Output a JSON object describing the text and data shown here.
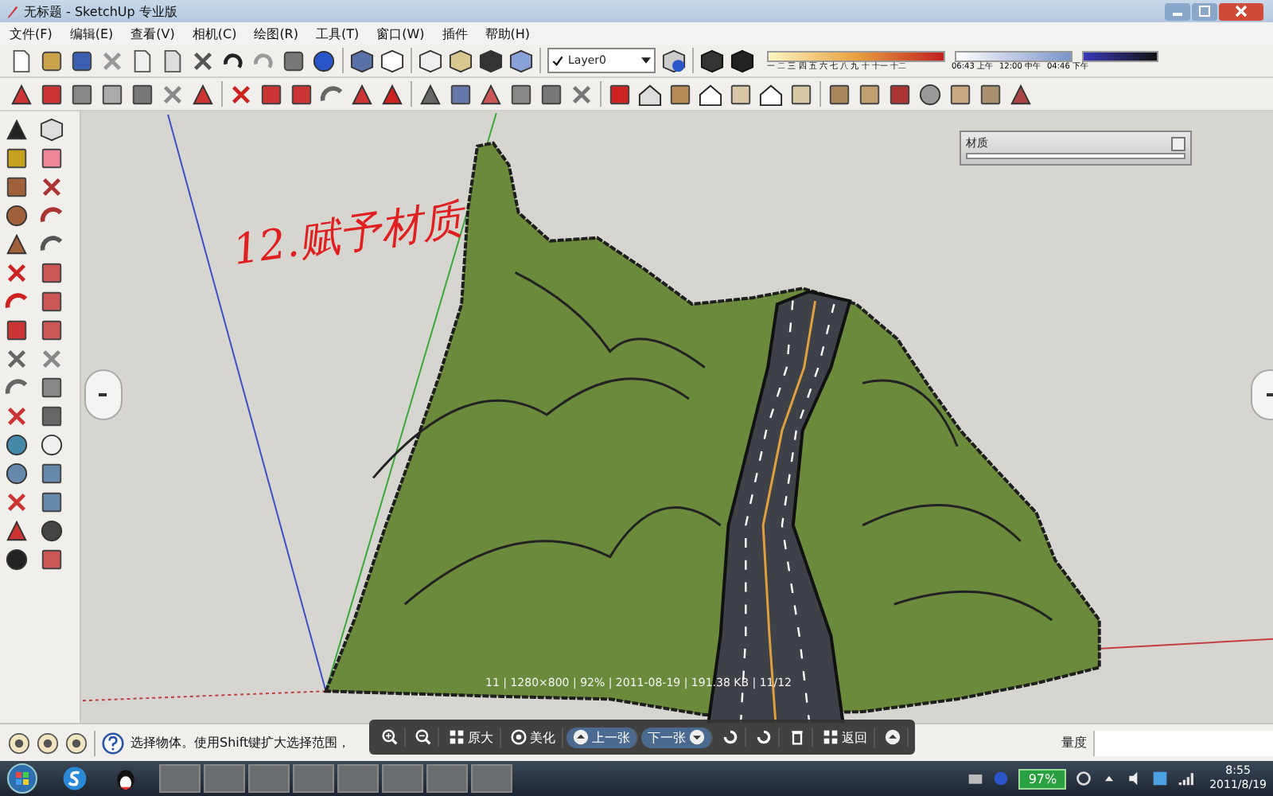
{
  "window": {
    "title": "无标题 - SketchUp 专业版"
  },
  "menu": [
    "文件(F)",
    "编辑(E)",
    "查看(V)",
    "相机(C)",
    "绘图(R)",
    "工具(T)",
    "窗口(W)",
    "插件",
    "帮助(H)"
  ],
  "layer_selector": {
    "value": "Layer0",
    "checked": true
  },
  "shadow_settings": {
    "months": "一 二 三 四 五 六 七 八 九 十 十一 十二",
    "times": [
      "06:43 上午",
      "12:00 中午",
      "04:46 下午"
    ]
  },
  "materials_panel": {
    "title": "材质"
  },
  "annotation": "12.赋予材质",
  "image_viewer": {
    "info": "11 | 1280×800 | 92% | 2011-08-19 | 191.38 KB | 11/12",
    "buttons": [
      {
        "kind": "zoom_in"
      },
      {
        "kind": "zoom_out"
      },
      {
        "kind": "actual_size",
        "label": "原大"
      },
      {
        "kind": "beautify",
        "label": "美化"
      },
      {
        "kind": "previous",
        "label": "上一张"
      },
      {
        "kind": "next",
        "label": "下一张"
      },
      {
        "kind": "rotate_left"
      },
      {
        "kind": "rotate_right"
      },
      {
        "kind": "delete"
      },
      {
        "kind": "back",
        "label": "返回"
      },
      {
        "kind": "collapse"
      }
    ]
  },
  "status_bar": {
    "hint": "选择物体。使用Shift键扩大选择范围，",
    "measurement_label": "量度"
  },
  "taskbar": {
    "battery": "97%",
    "time": "8:55",
    "date": "2011/8/19"
  }
}
